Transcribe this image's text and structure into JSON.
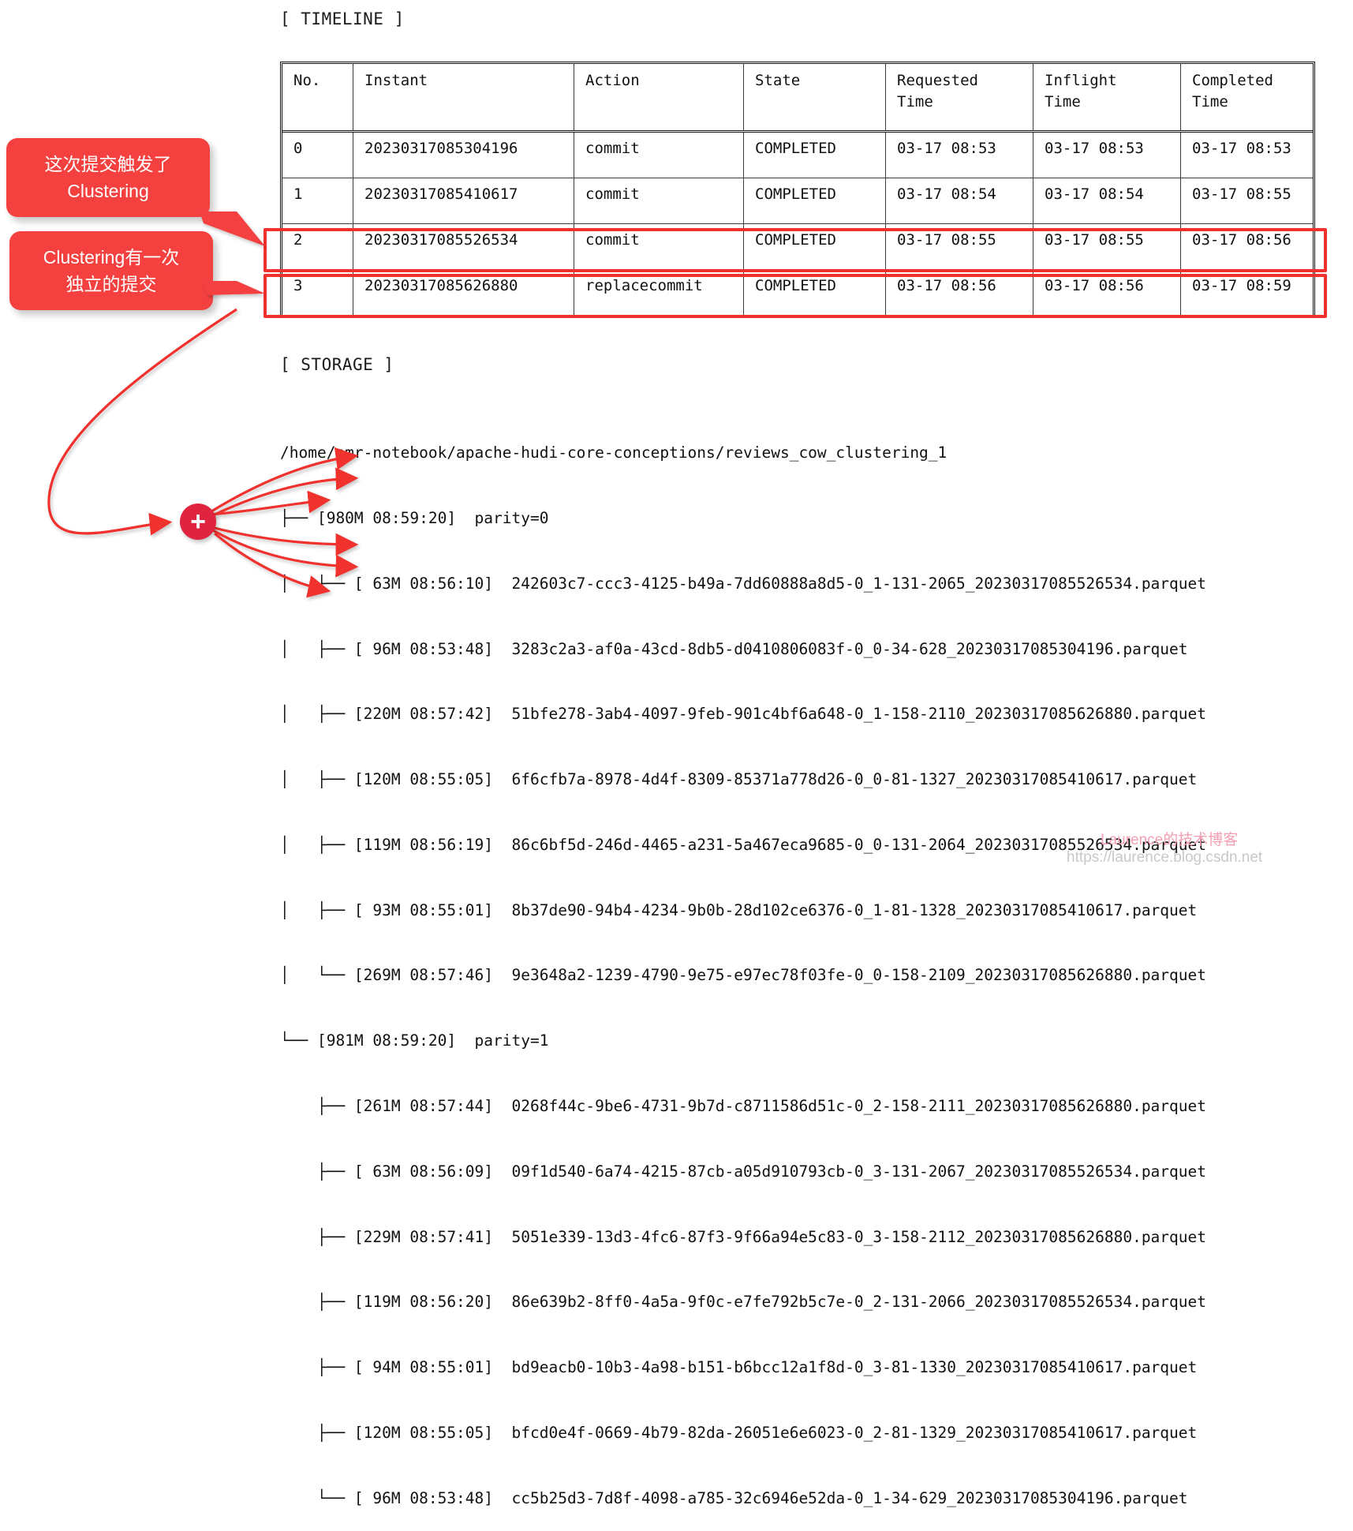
{
  "sections": {
    "timeline_label": "[ TIMELINE ]",
    "storage_label": "[ STORAGE ]"
  },
  "timeline": {
    "columns": [
      "No.",
      "Instant",
      "Action",
      "State",
      "Requested\nTime",
      "Inflight\nTime",
      "Completed\nTime"
    ],
    "rows": [
      {
        "no": "0",
        "instant": "20230317085304196",
        "action": "commit",
        "state": "COMPLETED",
        "requested_time": "03-17 08:53",
        "inflight_time": "03-17 08:53",
        "completed_time": "03-17 08:53",
        "highlighted": false
      },
      {
        "no": "1",
        "instant": "20230317085410617",
        "action": "commit",
        "state": "COMPLETED",
        "requested_time": "03-17 08:54",
        "inflight_time": "03-17 08:54",
        "completed_time": "03-17 08:55",
        "highlighted": false
      },
      {
        "no": "2",
        "instant": "20230317085526534",
        "action": "commit",
        "state": "COMPLETED",
        "requested_time": "03-17 08:55",
        "inflight_time": "03-17 08:55",
        "completed_time": "03-17 08:56",
        "highlighted": true
      },
      {
        "no": "3",
        "instant": "20230317085626880",
        "action": "replacecommit",
        "state": "COMPLETED",
        "requested_time": "03-17 08:56",
        "inflight_time": "03-17 08:56",
        "completed_time": "03-17 08:59",
        "highlighted": true
      }
    ]
  },
  "callouts": [
    {
      "id": "callout-1",
      "line1": "这次提交触发了",
      "line2": "Clustering"
    },
    {
      "id": "callout-2",
      "line1": "Clustering有一次",
      "line2": "独立的提交"
    }
  ],
  "storage": {
    "root_path": "/home/emr-notebook/apache-hudi-core-conceptions/reviews_cow_clustering_1",
    "lines": [
      "├── [980M 08:59:20]  parity=0",
      "│   ├── [ 63M 08:56:10]  242603c7-ccc3-4125-b49a-7dd60888a8d5-0_1-131-2065_20230317085526534.parquet",
      "│   ├── [ 96M 08:53:48]  3283c2a3-af0a-43cd-8db5-d0410806083f-0_0-34-628_20230317085304196.parquet",
      "│   ├── [220M 08:57:42]  51bfe278-3ab4-4097-9feb-901c4bf6a648-0_1-158-2110_20230317085626880.parquet",
      "│   ├── [120M 08:55:05]  6f6cfb7a-8978-4d4f-8309-85371a778d26-0_0-81-1327_20230317085410617.parquet",
      "│   ├── [119M 08:56:19]  86c6bf5d-246d-4465-a231-5a467eca9685-0_0-131-2064_20230317085526534.parquet",
      "│   ├── [ 93M 08:55:01]  8b37de90-94b4-4234-9b0b-28d102ce6376-0_1-81-1328_20230317085410617.parquet",
      "│   └── [269M 08:57:46]  9e3648a2-1239-4790-9e75-e97ec78f03fe-0_0-158-2109_20230317085626880.parquet",
      "└── [981M 08:59:20]  parity=1",
      "    ├── [261M 08:57:44]  0268f44c-9be6-4731-9b7d-c8711586d51c-0_2-158-2111_20230317085626880.parquet",
      "    ├── [ 63M 08:56:09]  09f1d540-6a74-4215-87cb-a05d910793cb-0_3-131-2067_20230317085526534.parquet",
      "    ├── [229M 08:57:41]  5051e339-13d3-4fc6-87f3-9f66a94e5c83-0_3-158-2112_20230317085626880.parquet",
      "    ├── [119M 08:56:20]  86e639b2-8ff0-4a5a-9f0c-e7fe792b5c7e-0_2-131-2066_20230317085526534.parquet",
      "    ├── [ 94M 08:55:01]  bd9eacb0-10b3-4a98-b151-b6bcc12a1f8d-0_3-81-1330_20230317085410617.parquet",
      "    ├── [120M 08:55:05]  bfcd0e4f-0669-4b79-82da-26051e6e6023-0_2-81-1329_20230317085410617.parquet",
      "    └── [ 96M 08:53:48]  cc5b25d3-7d8f-4098-a785-32c6946e52da-0_1-34-629_20230317085304196.parquet"
    ]
  },
  "badge": {
    "plus_label": "+"
  },
  "watermark": {
    "line1": "Laurence的技术博客",
    "line2": "https://laurence.blog.csdn.net"
  },
  "colors": {
    "accent_red": "#f4413f",
    "highlight_red": "#f0312e",
    "badge_red": "#e0243f",
    "text": "#111111"
  }
}
